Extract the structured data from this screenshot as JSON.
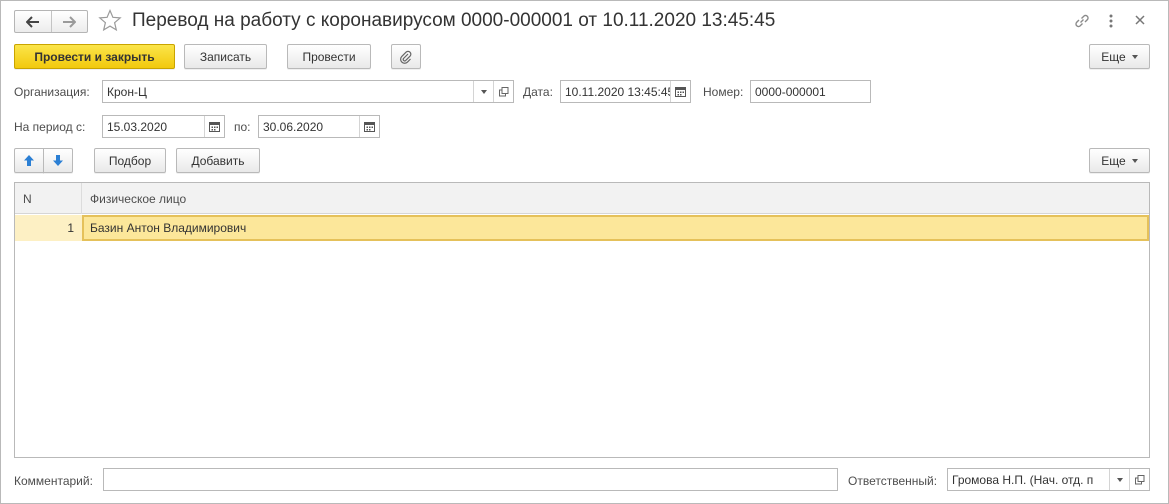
{
  "title": "Перевод на работу с коронавирусом 0000-000001 от 10.11.2020 13:45:45",
  "toolbar": {
    "post_and_close": "Провести и закрыть",
    "write": "Записать",
    "post": "Провести",
    "more": "Еще"
  },
  "form": {
    "organization_label": "Организация:",
    "organization_value": "Крон-Ц",
    "date_label": "Дата:",
    "date_value": "10.11.2020 13:45:45",
    "number_label": "Номер:",
    "number_value": "0000-000001",
    "period_label": "На период с:",
    "period_from": "15.03.2020",
    "period_to_label": "по:",
    "period_to": "30.06.2020"
  },
  "table_toolbar": {
    "select": "Подбор",
    "add": "Добавить",
    "more": "Еще"
  },
  "table": {
    "columns": [
      "N",
      "Физическое лицо"
    ],
    "rows": [
      {
        "n": "1",
        "person": "Базин Антон Владимирович"
      }
    ]
  },
  "footer": {
    "comment_label": "Комментарий:",
    "comment_value": "",
    "responsible_label": "Ответственный:",
    "responsible_value": "Громова Н.П. (Нач. отд. п"
  },
  "colors": {
    "primary_button": "#f5d21f",
    "selected_row": "#fce79a",
    "selected_row_border": "#e5c15a"
  },
  "icons": [
    "back-arrow-icon",
    "forward-arrow-icon",
    "star-icon",
    "link-icon",
    "more-vertical-icon",
    "close-icon",
    "paperclip-icon",
    "calendar-icon",
    "dropdown-arrow-icon",
    "open-form-icon",
    "move-up-icon",
    "move-down-icon"
  ]
}
